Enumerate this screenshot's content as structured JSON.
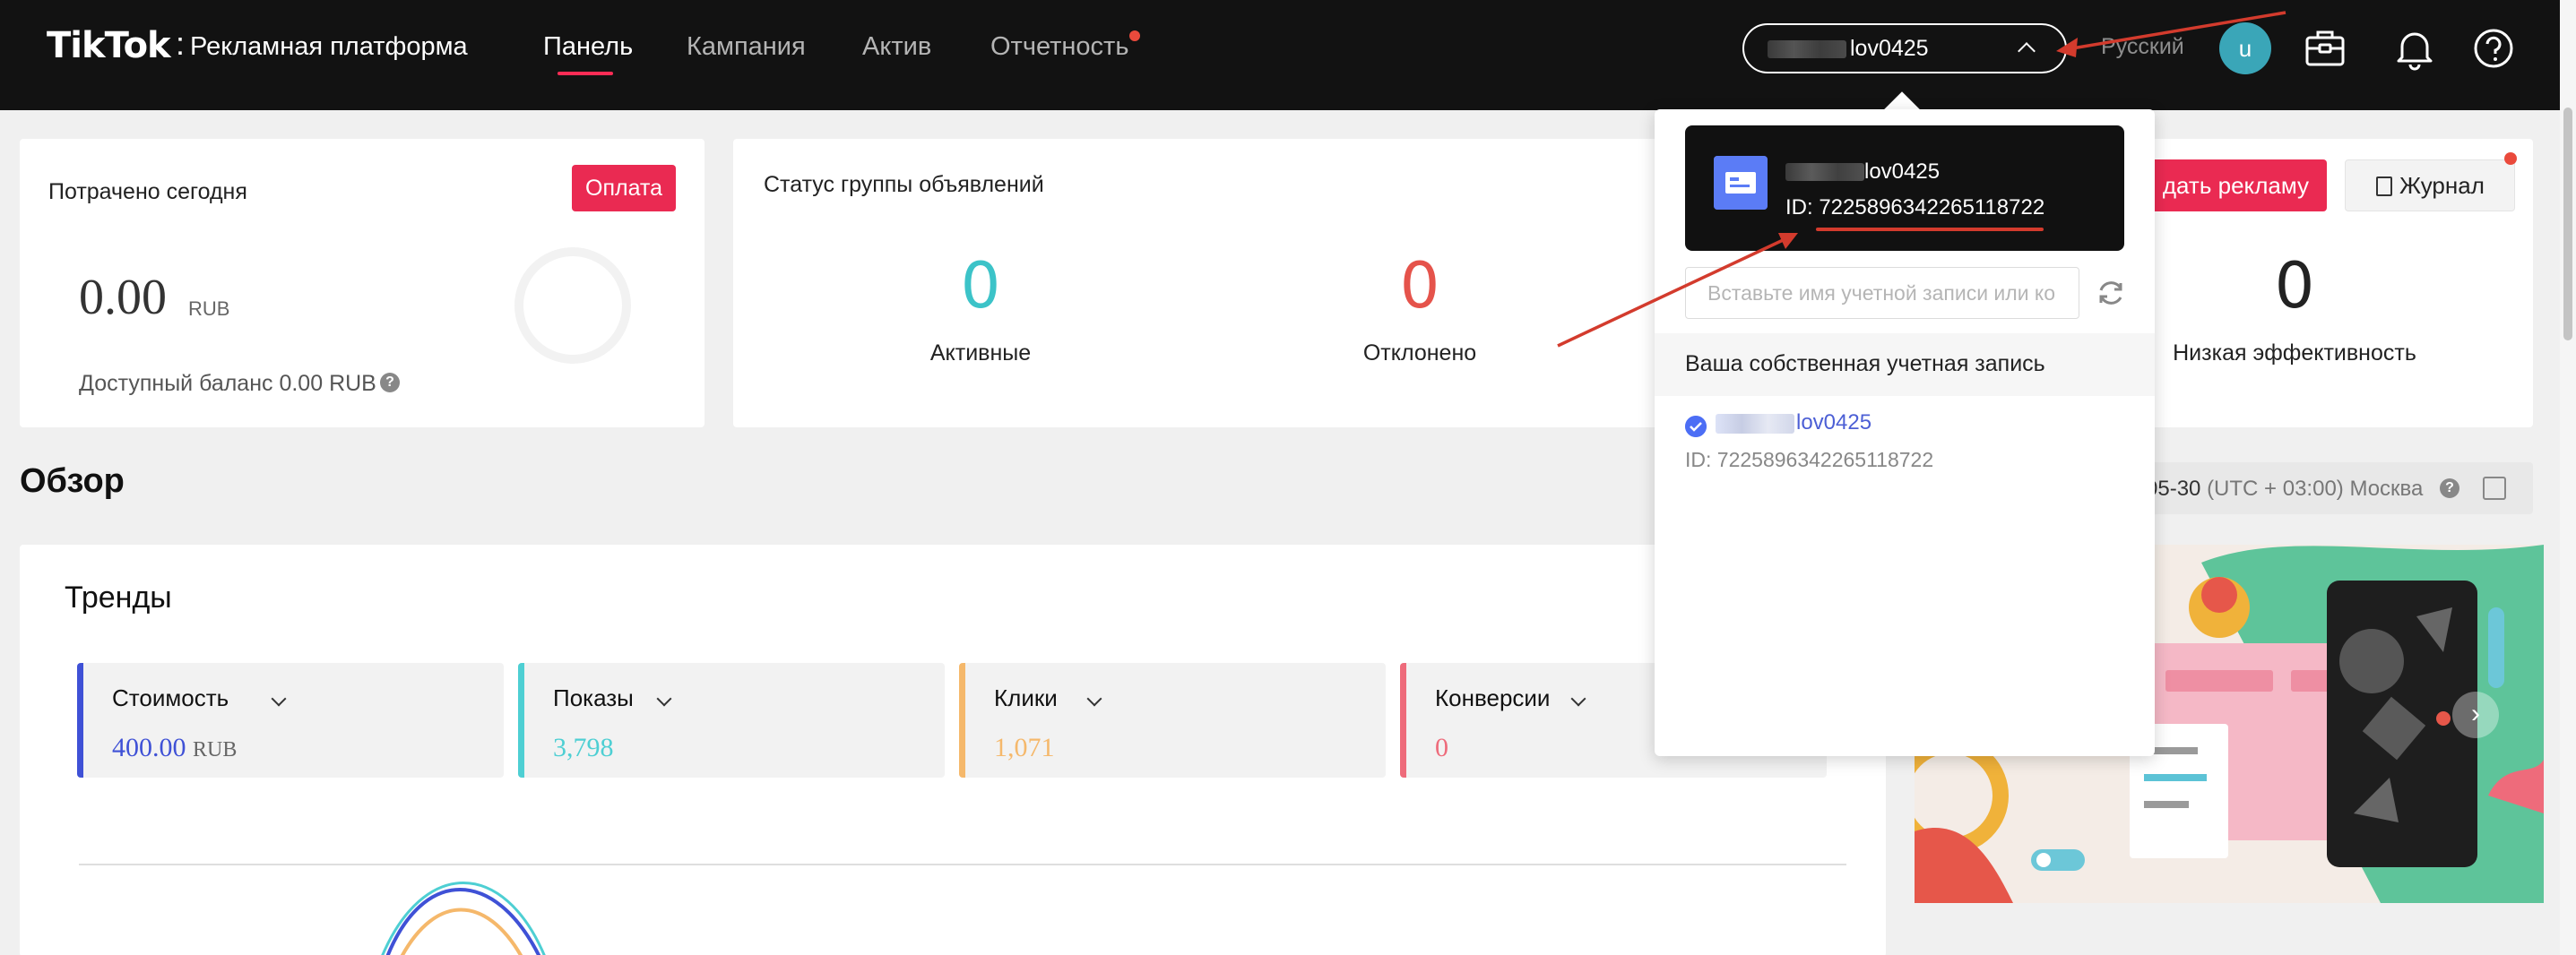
{
  "header": {
    "logo": "TikTok",
    "logo_separator": ":",
    "subtitle": "Рекламная платформа",
    "nav": [
      {
        "label": "Панель"
      },
      {
        "label": "Кампания"
      },
      {
        "label": "Актив"
      },
      {
        "label": "Отчетность"
      }
    ],
    "account_name": "lov0425",
    "language": "Русский",
    "avatar_letter": "u",
    "icons": [
      "briefcase-icon",
      "bell-icon",
      "help-icon"
    ]
  },
  "spent_card": {
    "title": "Потрачено сегодня",
    "pay_button": "Оплата",
    "amount": "0.00",
    "currency": "RUB",
    "available": "Доступный баланс 0.00 RUB"
  },
  "status_card": {
    "title": "Статус группы объявлений",
    "stats": [
      {
        "value": "0",
        "label": "Активные",
        "color": "#3cc3c8"
      },
      {
        "value": "0",
        "label": "Отклонено",
        "color": "#e5534b"
      },
      {
        "value": "0",
        "label": "Низкая эффективность",
        "color": "#222222"
      }
    ],
    "create_button": "дать рекламу",
    "journal_button": "Журнал"
  },
  "overview": {
    "title": "Обзор",
    "date_fragment": "05-30",
    "timezone": "(UTC + 03:00) Москва"
  },
  "trends": {
    "title": "Тренды",
    "metrics": [
      {
        "label": "Стоимость",
        "value": "400.00",
        "unit": "RUB",
        "color": "#3f51d6"
      },
      {
        "label": "Показы",
        "value": "3,798",
        "unit": "",
        "color": "#4ecfd3"
      },
      {
        "label": "Клики",
        "value": "1,071",
        "unit": "",
        "color": "#f5b86b"
      },
      {
        "label": "Конверсии",
        "value": "0",
        "unit": "",
        "color": "#ee6b7b"
      }
    ]
  },
  "dropdown": {
    "account_name": "lov0425",
    "account_id": "ID: 7225896342265118722",
    "search_placeholder": "Вставьте имя учетной записи или ко",
    "section_label": "Ваша собственная учетная запись",
    "own_account": {
      "name": "lov0425",
      "id": "ID: 7225896342265118722"
    }
  },
  "colors": {
    "accent": "#fe2c55",
    "annotation": "#d33b2d",
    "link": "#4c5fd5"
  }
}
